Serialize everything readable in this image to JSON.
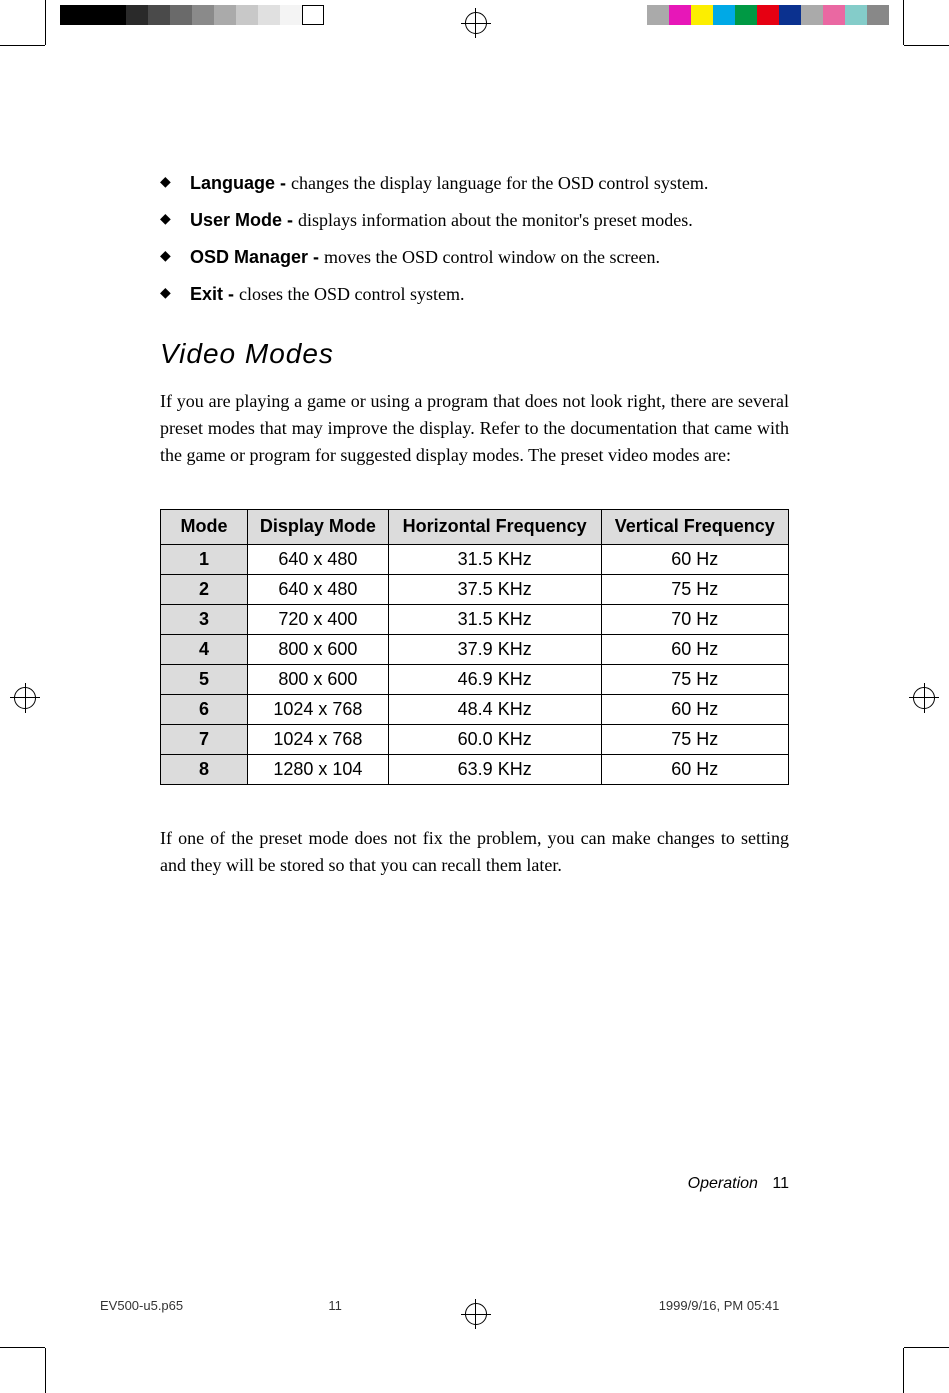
{
  "bullets": [
    {
      "label": "Language - ",
      "text": "changes the display language for the OSD control system."
    },
    {
      "label": "User Mode - ",
      "text": "displays information about the monitor's preset modes."
    },
    {
      "label": "OSD Manager - ",
      "text": "moves the OSD control window on the screen."
    },
    {
      "label": "Exit - ",
      "text": "closes the OSD control system."
    }
  ],
  "section_heading": "Video  Modes",
  "intro_paragraph": "If you are playing a game or using a program that does not look right, there are several preset modes that may improve the display. Refer to the documentation that came with the game or program for suggested display modes. The preset video modes are:",
  "table": {
    "headers": {
      "mode": "Mode",
      "display": "Display Mode",
      "hfreq": "Horizontal Frequency",
      "vfreq": "Vertical Frequency"
    },
    "rows": [
      {
        "mode": "1",
        "display": "640 x 480",
        "hfreq": "31.5 KHz",
        "vfreq": "60 Hz"
      },
      {
        "mode": "2",
        "display": "640 x 480",
        "hfreq": "37.5 KHz",
        "vfreq": "75 Hz"
      },
      {
        "mode": "3",
        "display": "720 x 400",
        "hfreq": "31.5 KHz",
        "vfreq": "70 Hz"
      },
      {
        "mode": "4",
        "display": "800 x 600",
        "hfreq": "37.9 KHz",
        "vfreq": "60 Hz"
      },
      {
        "mode": "5",
        "display": "800 x 600",
        "hfreq": "46.9 KHz",
        "vfreq": "75 Hz"
      },
      {
        "mode": "6",
        "display": "1024 x 768",
        "hfreq": "48.4 KHz",
        "vfreq": "60 Hz"
      },
      {
        "mode": "7",
        "display": "1024 x 768",
        "hfreq": "60.0 KHz",
        "vfreq": "75 Hz"
      },
      {
        "mode": "8",
        "display": "1280 x 104",
        "hfreq": "63.9 KHz",
        "vfreq": "60 Hz"
      }
    ]
  },
  "closing_paragraph": "If one of the preset mode does not fix the problem, you can make changes to setting and they will be stored so that you can recall them later.",
  "footer": {
    "section": "Operation",
    "page": "11"
  },
  "print_footer": {
    "file": "EV500-u5.p65",
    "page": "11",
    "timestamp": "1999/9/16, PM 05:41"
  }
}
